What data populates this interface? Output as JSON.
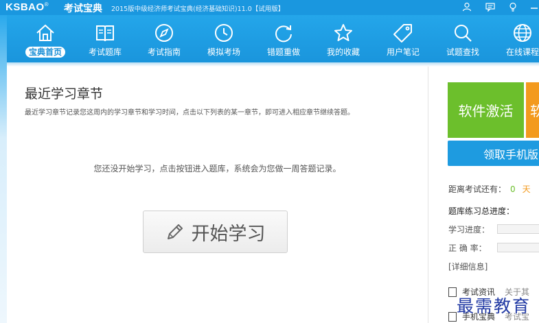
{
  "titlebar": {
    "brand": "KSBAO",
    "brand_cn": "考试宝典",
    "edition": "2015版中级经济师考试宝典(经济基础知识)11.0【试用版】",
    "icons": [
      "user-icon",
      "message-icon",
      "bulb-icon",
      "minimize-icon"
    ]
  },
  "nav": {
    "items": [
      {
        "label": "宝典首页",
        "icon": "home-icon",
        "active": true
      },
      {
        "label": "考试题库",
        "icon": "book-icon"
      },
      {
        "label": "考试指南",
        "icon": "compass-icon"
      },
      {
        "label": "模拟考场",
        "icon": "clock-icon"
      },
      {
        "label": "错题重做",
        "icon": "refresh-icon"
      },
      {
        "label": "我的收藏",
        "icon": "star-icon"
      },
      {
        "label": "用户笔记",
        "icon": "tag-icon"
      },
      {
        "label": "试题查找",
        "icon": "search-icon"
      },
      {
        "label": "在线课程",
        "icon": "globe-icon"
      }
    ]
  },
  "main": {
    "title": "最近学习章节",
    "description": "最近学习章节记录您这周内的学习章节和学习时间，点击以下列表的某一章节，即可进入相应章节继续答题。",
    "empty_message": "您还没开始学习，点击按钮进入题库，系统会为您做一周答题记录。",
    "start_button": "开始学习"
  },
  "sidebar": {
    "activate_label": "软件激活",
    "orange_label": "软",
    "mobile_label": "领取手机版",
    "countdown_label": "距离考试还有：",
    "countdown_value": "0",
    "countdown_unit": "天",
    "progress_title": "题库练习总进度：",
    "study_progress_label": "学习进度：",
    "accuracy_label": "正 确 率：",
    "detail_link": "[详细信息]",
    "links": [
      {
        "label": "考试资讯",
        "sub": "关于其"
      },
      {
        "label": "手机宝典",
        "sub": "考试宝"
      }
    ]
  },
  "watermark": "最需教育",
  "colors": {
    "nav_blue": "#1a95dc",
    "activate_green": "#6cbf2c",
    "orange": "#f39a1e",
    "mobile_blue": "#1e9be0"
  }
}
